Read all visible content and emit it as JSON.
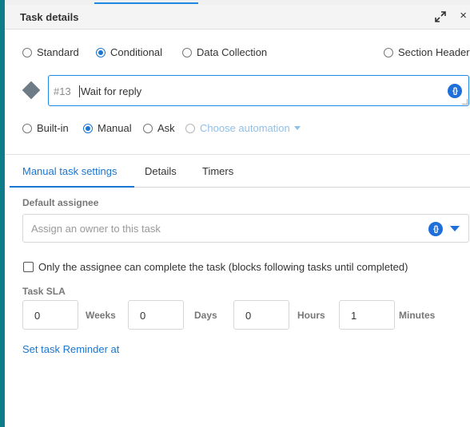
{
  "header": {
    "title": "Task details",
    "expand_icon": "expand-icon",
    "close_icon": "close-icon",
    "close_glyph": "×"
  },
  "task_type": {
    "options": [
      "Standard",
      "Conditional",
      "Data Collection",
      "Section Header"
    ],
    "selected": "Conditional"
  },
  "task": {
    "number": "#13",
    "name": "Wait for reply",
    "variable_icon": "{}"
  },
  "execution": {
    "options": [
      "Built-in",
      "Manual",
      "Ask",
      "Choose automation"
    ],
    "selected": "Manual"
  },
  "tabs": [
    {
      "label": "Manual task settings",
      "active": true
    },
    {
      "label": "Details",
      "active": false
    },
    {
      "label": "Timers",
      "active": false
    }
  ],
  "assignee": {
    "label": "Default assignee",
    "placeholder": "Assign an owner to this task",
    "variable_icon": "{}"
  },
  "only_assignee_checkbox": {
    "label": "Only the assignee can complete the task (blocks following tasks until completed)",
    "checked": false
  },
  "sla": {
    "label": "Task SLA",
    "fields": [
      {
        "value": "0",
        "unit": "Weeks"
      },
      {
        "value": "0",
        "unit": "Days"
      },
      {
        "value": "0",
        "unit": "Hours"
      },
      {
        "value": "1",
        "unit": "Minutes"
      }
    ]
  },
  "reminder_link": "Set task Reminder at",
  "colors": {
    "accent": "#1976d2",
    "left_bar": "#0f7c8a",
    "diamond": "#6d7b86",
    "muted_link": "#90c0e8"
  }
}
